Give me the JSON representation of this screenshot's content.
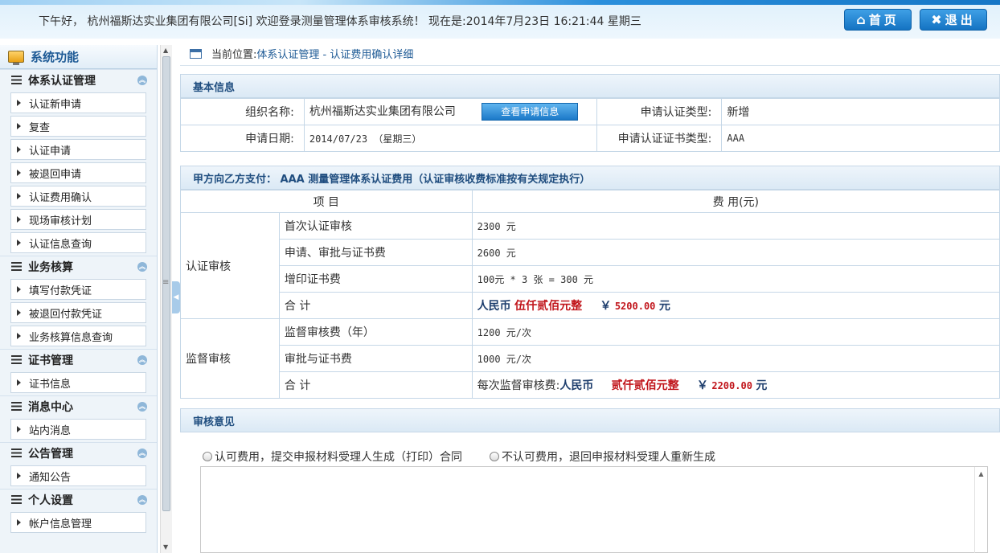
{
  "header": {
    "greeting": "下午好， 杭州福斯达实业集团有限公司[Si] 欢迎登录测量管理体系审核系统！ 现在是:2014年7月23日 16:21:44 星期三",
    "home_label": "首页",
    "exit_label": "退出"
  },
  "sidebar": {
    "title": "系统功能",
    "groups": [
      {
        "label": "体系认证管理",
        "items": [
          "认证新申请",
          "复查",
          "认证申请",
          "被退回申请",
          "认证费用确认",
          "现场审核计划",
          "认证信息查询"
        ]
      },
      {
        "label": "业务核算",
        "items": [
          "填写付款凭证",
          "被退回付款凭证",
          "业务核算信息查询"
        ]
      },
      {
        "label": "证书管理",
        "items": [
          "证书信息"
        ]
      },
      {
        "label": "消息中心",
        "items": [
          "站内消息"
        ]
      },
      {
        "label": "公告管理",
        "items": [
          "通知公告"
        ]
      },
      {
        "label": "个人设置",
        "items": [
          "帐户信息管理"
        ]
      }
    ]
  },
  "breadcrumb": {
    "label": "当前位置:",
    "path": "体系认证管理 - 认证费用确认详细"
  },
  "basic": {
    "section_title": "基本信息",
    "org_label": "组织名称:",
    "org_value": "杭州福斯达实业集团有限公司",
    "view_button": "查看申请信息",
    "type_label": "申请认证类型:",
    "type_value": "新增",
    "date_label": "申请日期:",
    "date_value": "2014/07/23 （星期三）",
    "cert_type_label": "申请认证证书类型:",
    "cert_type_value": "AAA"
  },
  "fees": {
    "section_title": "甲方向乙方支付： AAA 测量管理体系认证费用（认证审核收费标准按有关规定执行）",
    "col_item": "项 目",
    "col_fee": "费 用(元)",
    "cert_group": "认证审核",
    "cert_rows": [
      {
        "item": "首次认证审核",
        "fee": "2300 元"
      },
      {
        "item": "申请、审批与证书费",
        "fee": "2600 元"
      },
      {
        "item": "增印证书费",
        "fee": "100元 * 3 张 = 300 元"
      }
    ],
    "cert_total_label": "合 计",
    "cert_total_prefix": "人民币",
    "cert_total_words": "伍仟贰佰元整",
    "cert_total_symbol": "￥",
    "cert_total_num": "5200.00",
    "cert_total_unit": "元",
    "sup_group": "监督审核",
    "sup_rows": [
      {
        "item": "监督审核费（年）",
        "fee": "1200 元/次"
      },
      {
        "item": "审批与证书费",
        "fee": "1000 元/次"
      }
    ],
    "sup_total_label": "合 计",
    "sup_total_pre": "每次监督审核费:",
    "sup_total_prefix": "人民币",
    "sup_total_words": "贰仟贰佰元整",
    "sup_total_symbol": "￥",
    "sup_total_num": "2200.00",
    "sup_total_unit": "元"
  },
  "review": {
    "section_title": "审核意见",
    "option_accept": "认可费用，提交申报材料受理人生成（打印）合同",
    "option_reject": "不认可费用，退回申报材料受理人重新生成"
  }
}
